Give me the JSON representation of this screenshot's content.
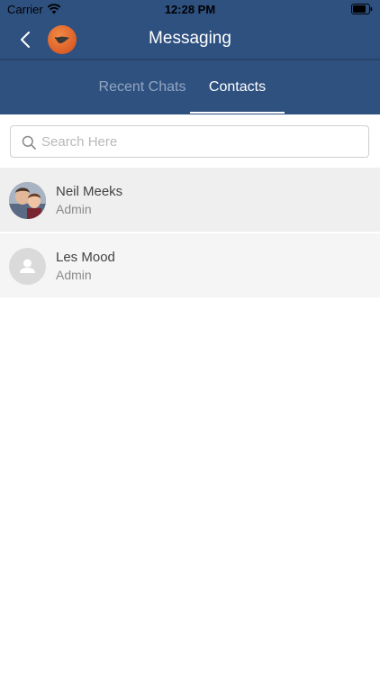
{
  "status_bar": {
    "carrier": "Carrier",
    "time": "12:28 PM"
  },
  "nav": {
    "title": "Messaging"
  },
  "tabs": [
    {
      "label": "Recent Chats",
      "active": false
    },
    {
      "label": "Contacts",
      "active": true
    }
  ],
  "search": {
    "placeholder": "Search Here",
    "value": ""
  },
  "contacts": [
    {
      "name": "Neil Meeks",
      "role": "Admin",
      "avatar": "photo"
    },
    {
      "name": "Les Mood",
      "role": "Admin",
      "avatar": "default-person-icon"
    }
  ],
  "colors": {
    "header_bg": "#2f5180",
    "tab_inactive": "#93a6c2",
    "tab_active": "#ffffff",
    "logo_accent": "#e0642a"
  }
}
